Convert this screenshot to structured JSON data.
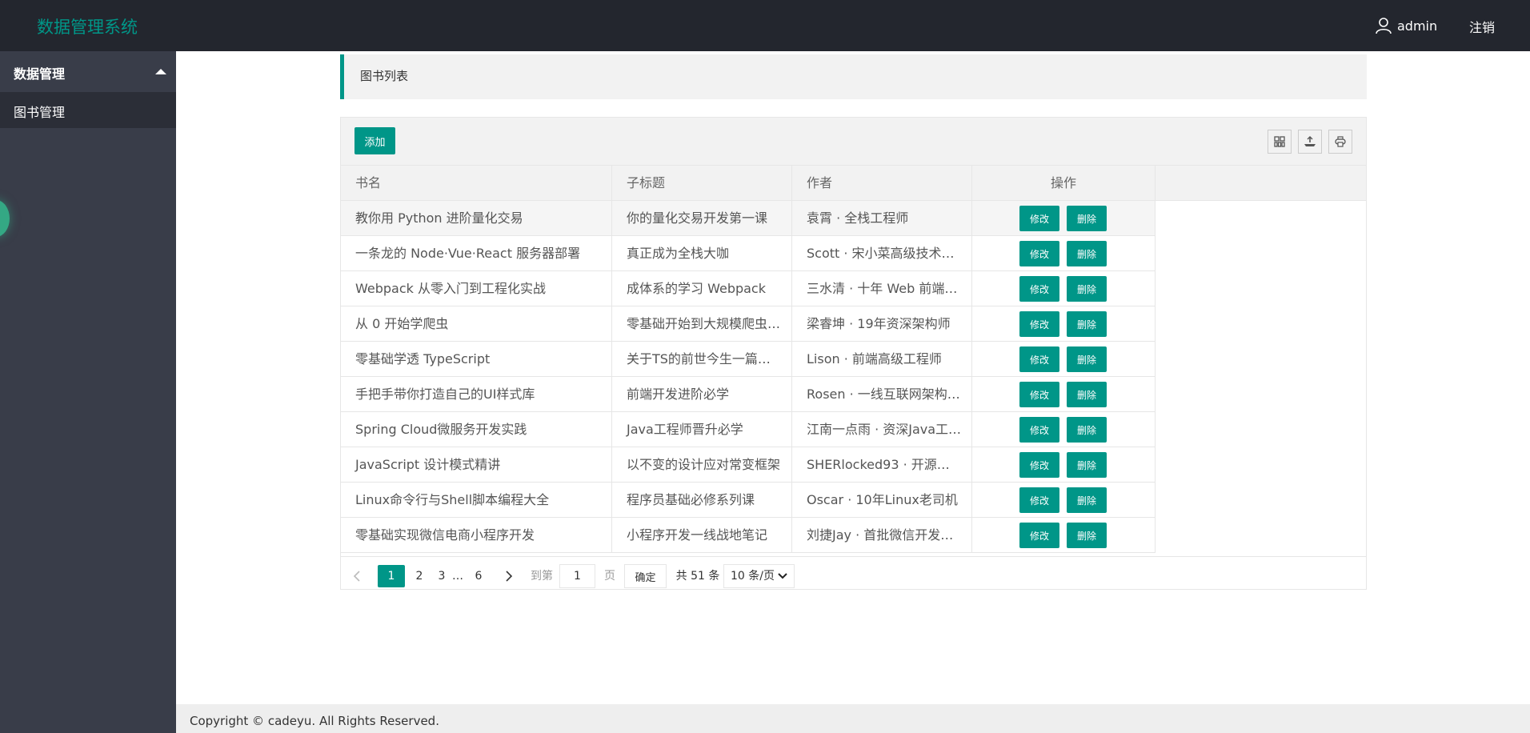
{
  "header": {
    "app_title": "数据管理系统",
    "username": "admin",
    "logout_label": "注销"
  },
  "sidebar": {
    "group_label": "数据管理",
    "items": [
      {
        "label": "图书管理"
      }
    ]
  },
  "page": {
    "title": "图书列表"
  },
  "toolbar": {
    "add_label": "添加"
  },
  "table": {
    "columns": [
      "书名",
      "子标题",
      "作者",
      "操作"
    ],
    "edit_label": "修改",
    "delete_label": "删除",
    "rows": [
      {
        "title": "教你用 Python 进阶量化交易",
        "subtitle": "你的量化交易开发第一课",
        "author": "袁霄 · 全栈工程师"
      },
      {
        "title": "一条龙的 Node·Vue·React 服务器部署",
        "subtitle": "真正成为全栈大咖",
        "author": "Scott · 宋小菜高级技术…"
      },
      {
        "title": "Webpack 从零入门到工程化实战",
        "subtitle": "成体系的学习 Webpack",
        "author": "三水清 · 十年 Web 前端…"
      },
      {
        "title": "从 0 开始学爬虫",
        "subtitle": "零基础开始到大规模爬虫…",
        "author": "梁睿坤 · 19年资深架构师"
      },
      {
        "title": "零基础学透 TypeScript",
        "subtitle": "关于TS的前世今生一篇…",
        "author": "Lison · 前端高级工程师"
      },
      {
        "title": "手把手带你打造自己的UI样式库",
        "subtitle": "前端开发进阶必学",
        "author": "Rosen · 一线互联网架构…"
      },
      {
        "title": "Spring Cloud微服务开发实践",
        "subtitle": "Java工程师晋升必学",
        "author": "江南一点雨 · 资深Java工…"
      },
      {
        "title": "JavaScript 设计模式精讲",
        "subtitle": "以不变的设计应对常变框架",
        "author": "SHERlocked93 · 开源社…"
      },
      {
        "title": "Linux命令行与Shell脚本编程大全",
        "subtitle": "程序员基础必修系列课",
        "author": "Oscar · 10年Linux老司机"
      },
      {
        "title": "零基础实现微信电商小程序开发",
        "subtitle": "小程序开发一线战地笔记",
        "author": "刘捷Jay · 首批微信开发…"
      }
    ]
  },
  "pagination": {
    "pages": [
      "1",
      "2",
      "3",
      "…",
      "6"
    ],
    "goto_label": "到第",
    "goto_value": "1",
    "page_unit": "页",
    "confirm_label": "确定",
    "total_text": "共 51 条",
    "page_size": "10 条/页"
  },
  "footer": {
    "copyright": "Copyright © cadeyu. All Rights Reserved."
  },
  "colors": {
    "accent": "#009688",
    "header_bg": "#23262e",
    "sidebar_bg": "#393d49"
  }
}
